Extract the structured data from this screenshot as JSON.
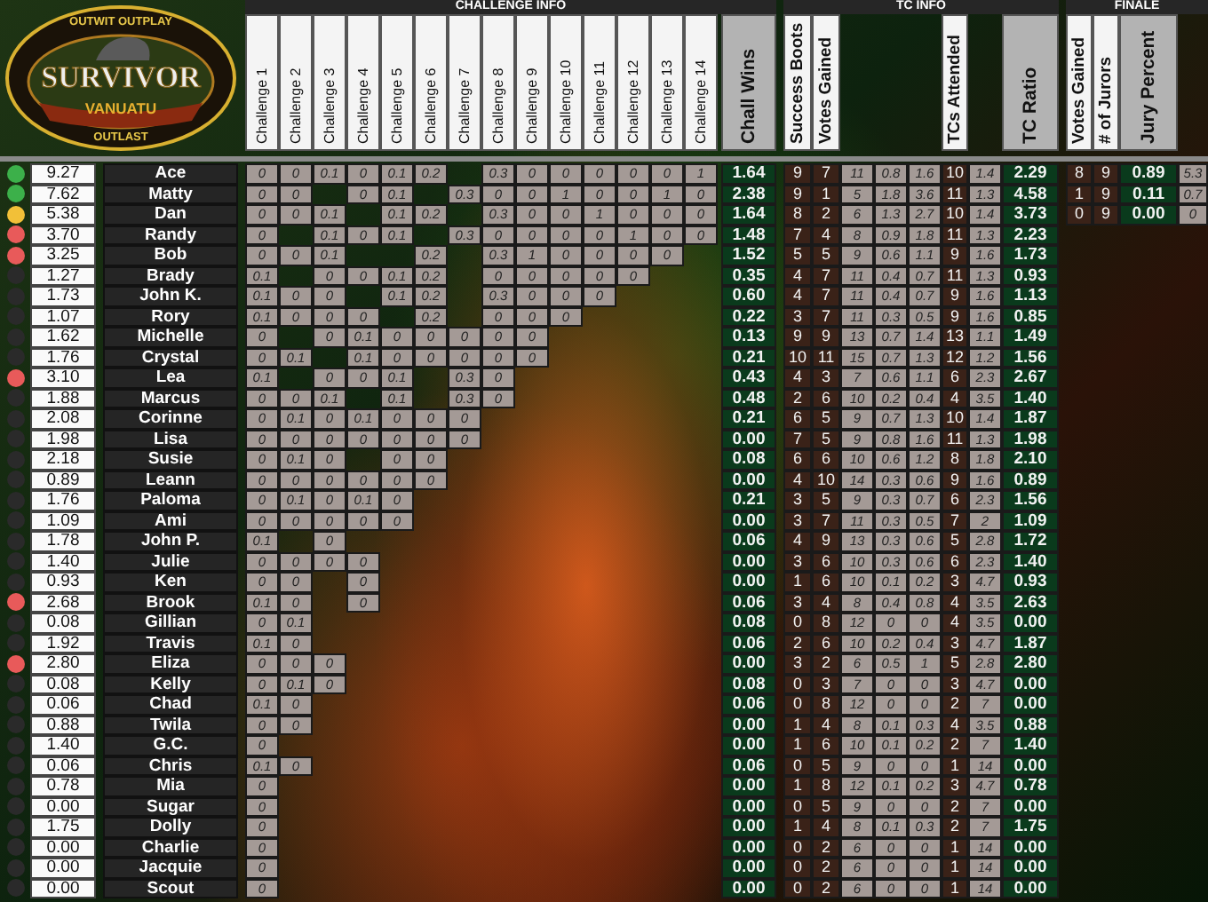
{
  "logo": {
    "top": "OUTWIT OUTPLAY",
    "title": "SURVIVOR",
    "subtitle": "VANUATU",
    "bottom": "OUTLAST"
  },
  "challenge_info": {
    "title": "CHALLENGE INFO",
    "columns": [
      "Challenge 1",
      "Challenge 2",
      "Challenge 3",
      "Challenge 4",
      "Challenge 5",
      "Challenge 6",
      "Challenge 7",
      "Challenge 8",
      "Challenge 9",
      "Challenge 10",
      "Challenge 11",
      "Challenge 12",
      "Challenge 13",
      "Challenge 14"
    ],
    "total": "Chall Wins"
  },
  "tc_info": {
    "title": "TC INFO",
    "columns": [
      {
        "label": "Success Boots",
        "kind": "dark"
      },
      {
        "label": "Votes Gained",
        "kind": "dark"
      },
      {
        "kind": "light"
      },
      {
        "kind": "light"
      },
      {
        "kind": "light"
      },
      {
        "label": "TCs Attended",
        "kind": "dark"
      },
      {
        "kind": "light"
      },
      {
        "label": "TC Ratio",
        "kind": "total"
      }
    ]
  },
  "finale": {
    "title": "FINALE",
    "columns": [
      {
        "label": "Votes Gained",
        "kind": "dark"
      },
      {
        "label": "# of Jurors",
        "kind": "dark"
      },
      {
        "label": "Jury Percent",
        "kind": "total"
      },
      {
        "kind": "light"
      }
    ]
  },
  "rows": [
    {
      "color": "#3cb04a",
      "score": "9.27",
      "name": "Ace",
      "challenges": [
        {
          "value": "0"
        },
        {
          "value": "0"
        },
        {
          "value": "0.1"
        },
        {
          "value": "0"
        },
        {
          "value": "0.1"
        },
        {
          "value": "0.2"
        },
        {
          "blank": true
        },
        {
          "value": "0.3"
        },
        {
          "value": "0"
        },
        {
          "value": "0"
        },
        {
          "value": "0"
        },
        {
          "value": "0"
        },
        {
          "value": "0"
        },
        {
          "value": "1"
        }
      ],
      "chall_wins": "1.64",
      "tc": [
        "9",
        "7",
        "11",
        "0.8",
        "1.6",
        "10",
        "1.4",
        "2.29"
      ],
      "finale": [
        "8",
        "9",
        "0.89",
        "5.3"
      ]
    },
    {
      "color": "#3cb04a",
      "score": "7.62",
      "name": "Matty",
      "challenges": [
        {
          "value": "0"
        },
        {
          "value": "0"
        },
        {
          "blank": true
        },
        {
          "value": "0"
        },
        {
          "value": "0.1"
        },
        {
          "blank": true
        },
        {
          "value": "0.3"
        },
        {
          "value": "0"
        },
        {
          "value": "0"
        },
        {
          "value": "1"
        },
        {
          "value": "0"
        },
        {
          "value": "0"
        },
        {
          "value": "1"
        },
        {
          "value": "0"
        }
      ],
      "chall_wins": "2.38",
      "tc": [
        "9",
        "1",
        "5",
        "1.8",
        "3.6",
        "11",
        "1.3",
        "4.58"
      ],
      "finale": [
        "1",
        "9",
        "0.11",
        "0.7"
      ]
    },
    {
      "color": "#f2c038",
      "score": "5.38",
      "name": "Dan",
      "challenges": [
        {
          "value": "0"
        },
        {
          "value": "0"
        },
        {
          "value": "0.1"
        },
        {
          "blank": true
        },
        {
          "value": "0.1"
        },
        {
          "value": "0.2"
        },
        {
          "blank": true
        },
        {
          "value": "0.3"
        },
        {
          "value": "0"
        },
        {
          "value": "0"
        },
        {
          "value": "1"
        },
        {
          "value": "0"
        },
        {
          "value": "0"
        },
        {
          "value": "0"
        }
      ],
      "chall_wins": "1.64",
      "tc": [
        "8",
        "2",
        "6",
        "1.3",
        "2.7",
        "10",
        "1.4",
        "3.73"
      ],
      "finale": [
        "0",
        "9",
        "0.00",
        "0"
      ]
    },
    {
      "color": "#e85a5a",
      "score": "3.70",
      "name": "Randy",
      "challenges": [
        {
          "value": "0"
        },
        {
          "blank": true
        },
        {
          "value": "0.1"
        },
        {
          "value": "0"
        },
        {
          "value": "0.1"
        },
        {
          "blank": true
        },
        {
          "value": "0.3"
        },
        {
          "value": "0"
        },
        {
          "value": "0"
        },
        {
          "value": "0"
        },
        {
          "value": "0"
        },
        {
          "value": "1"
        },
        {
          "value": "0"
        },
        {
          "value": "0"
        }
      ],
      "chall_wins": "1.48",
      "tc": [
        "7",
        "4",
        "8",
        "0.9",
        "1.8",
        "11",
        "1.3",
        "2.23"
      ]
    },
    {
      "color": "#e85a5a",
      "score": "3.25",
      "name": "Bob",
      "challenges": [
        {
          "value": "0"
        },
        {
          "value": "0"
        },
        {
          "value": "0.1"
        },
        {
          "blank": true
        },
        {
          "blank": true
        },
        {
          "value": "0.2"
        },
        {
          "blank": true
        },
        {
          "value": "0.3"
        },
        {
          "value": "1"
        },
        {
          "value": "0"
        },
        {
          "value": "0"
        },
        {
          "value": "0"
        },
        {
          "value": "0"
        }
      ],
      "chall_wins": "1.52",
      "tc": [
        "5",
        "5",
        "9",
        "0.6",
        "1.1",
        "9",
        "1.6",
        "1.73"
      ]
    },
    {
      "color": "#2a2a2a",
      "score": "1.27",
      "name": "Brady",
      "challenges": [
        {
          "value": "0.1"
        },
        {
          "blank": true
        },
        {
          "value": "0"
        },
        {
          "value": "0"
        },
        {
          "value": "0.1"
        },
        {
          "value": "0.2"
        },
        {
          "blank": true
        },
        {
          "value": "0"
        },
        {
          "value": "0"
        },
        {
          "value": "0"
        },
        {
          "value": "0"
        },
        {
          "value": "0"
        }
      ],
      "chall_wins": "0.35",
      "tc": [
        "4",
        "7",
        "11",
        "0.4",
        "0.7",
        "11",
        "1.3",
        "0.93"
      ]
    },
    {
      "color": "#2a2a2a",
      "score": "1.73",
      "name": "John K.",
      "challenges": [
        {
          "value": "0.1"
        },
        {
          "value": "0"
        },
        {
          "value": "0"
        },
        {
          "blank": true
        },
        {
          "value": "0.1"
        },
        {
          "value": "0.2"
        },
        {
          "blank": true
        },
        {
          "value": "0.3"
        },
        {
          "value": "0"
        },
        {
          "value": "0"
        },
        {
          "value": "0"
        }
      ],
      "chall_wins": "0.60",
      "tc": [
        "4",
        "7",
        "11",
        "0.4",
        "0.7",
        "9",
        "1.6",
        "1.13"
      ]
    },
    {
      "color": "#2a2a2a",
      "score": "1.07",
      "name": "Rory",
      "challenges": [
        {
          "value": "0.1"
        },
        {
          "value": "0"
        },
        {
          "value": "0"
        },
        {
          "value": "0"
        },
        {
          "blank": true
        },
        {
          "value": "0.2"
        },
        {
          "blank": true
        },
        {
          "value": "0"
        },
        {
          "value": "0"
        },
        {
          "value": "0"
        }
      ],
      "chall_wins": "0.22",
      "tc": [
        "3",
        "7",
        "11",
        "0.3",
        "0.5",
        "9",
        "1.6",
        "0.85"
      ]
    },
    {
      "color": "#2a2a2a",
      "score": "1.62",
      "name": "Michelle",
      "challenges": [
        {
          "value": "0"
        },
        {
          "blank": true
        },
        {
          "value": "0"
        },
        {
          "value": "0.1"
        },
        {
          "value": "0"
        },
        {
          "value": "0"
        },
        {
          "value": "0"
        },
        {
          "value": "0"
        },
        {
          "value": "0"
        }
      ],
      "chall_wins": "0.13",
      "tc": [
        "9",
        "9",
        "13",
        "0.7",
        "1.4",
        "13",
        "1.1",
        "1.49"
      ]
    },
    {
      "color": "#2a2a2a",
      "score": "1.76",
      "name": "Crystal",
      "challenges": [
        {
          "value": "0"
        },
        {
          "value": "0.1"
        },
        {
          "blank": true
        },
        {
          "value": "0.1"
        },
        {
          "value": "0"
        },
        {
          "value": "0"
        },
        {
          "value": "0"
        },
        {
          "value": "0"
        },
        {
          "value": "0"
        }
      ],
      "chall_wins": "0.21",
      "tc": [
        "10",
        "11",
        "15",
        "0.7",
        "1.3",
        "12",
        "1.2",
        "1.56"
      ]
    },
    {
      "color": "#e85a5a",
      "score": "3.10",
      "name": "Lea",
      "challenges": [
        {
          "value": "0.1"
        },
        {
          "blank": true
        },
        {
          "value": "0"
        },
        {
          "value": "0"
        },
        {
          "value": "0.1"
        },
        {
          "blank": true
        },
        {
          "value": "0.3"
        },
        {
          "value": "0"
        }
      ],
      "chall_wins": "0.43",
      "tc": [
        "4",
        "3",
        "7",
        "0.6",
        "1.1",
        "6",
        "2.3",
        "2.67"
      ]
    },
    {
      "color": "#2a2a2a",
      "score": "1.88",
      "name": "Marcus",
      "challenges": [
        {
          "value": "0"
        },
        {
          "value": "0"
        },
        {
          "value": "0.1"
        },
        {
          "blank": true
        },
        {
          "value": "0.1"
        },
        {
          "blank": true
        },
        {
          "value": "0.3"
        },
        {
          "value": "0"
        }
      ],
      "chall_wins": "0.48",
      "tc": [
        "2",
        "6",
        "10",
        "0.2",
        "0.4",
        "4",
        "3.5",
        "1.40"
      ]
    },
    {
      "color": "#2a2a2a",
      "score": "2.08",
      "name": "Corinne",
      "challenges": [
        {
          "value": "0"
        },
        {
          "value": "0.1"
        },
        {
          "value": "0"
        },
        {
          "value": "0.1"
        },
        {
          "value": "0"
        },
        {
          "value": "0"
        },
        {
          "value": "0"
        }
      ],
      "chall_wins": "0.21",
      "tc": [
        "6",
        "5",
        "9",
        "0.7",
        "1.3",
        "10",
        "1.4",
        "1.87"
      ]
    },
    {
      "color": "#2a2a2a",
      "score": "1.98",
      "name": "Lisa",
      "challenges": [
        {
          "value": "0"
        },
        {
          "value": "0"
        },
        {
          "value": "0"
        },
        {
          "value": "0"
        },
        {
          "value": "0"
        },
        {
          "value": "0"
        },
        {
          "value": "0"
        }
      ],
      "chall_wins": "0.00",
      "tc": [
        "7",
        "5",
        "9",
        "0.8",
        "1.6",
        "11",
        "1.3",
        "1.98"
      ]
    },
    {
      "color": "#2a2a2a",
      "score": "2.18",
      "name": "Susie",
      "challenges": [
        {
          "value": "0"
        },
        {
          "value": "0.1"
        },
        {
          "value": "0"
        },
        {
          "blank": true
        },
        {
          "value": "0"
        },
        {
          "value": "0"
        }
      ],
      "chall_wins": "0.08",
      "tc": [
        "6",
        "6",
        "10",
        "0.6",
        "1.2",
        "8",
        "1.8",
        "2.10"
      ]
    },
    {
      "color": "#2a2a2a",
      "score": "0.89",
      "name": "Leann",
      "challenges": [
        {
          "value": "0"
        },
        {
          "value": "0"
        },
        {
          "value": "0"
        },
        {
          "value": "0"
        },
        {
          "value": "0"
        },
        {
          "value": "0"
        }
      ],
      "chall_wins": "0.00",
      "tc": [
        "4",
        "10",
        "14",
        "0.3",
        "0.6",
        "9",
        "1.6",
        "0.89"
      ]
    },
    {
      "color": "#2a2a2a",
      "score": "1.76",
      "name": "Paloma",
      "challenges": [
        {
          "value": "0"
        },
        {
          "value": "0.1"
        },
        {
          "value": "0"
        },
        {
          "value": "0.1"
        },
        {
          "value": "0"
        }
      ],
      "chall_wins": "0.21",
      "tc": [
        "3",
        "5",
        "9",
        "0.3",
        "0.7",
        "6",
        "2.3",
        "1.56"
      ]
    },
    {
      "color": "#2a2a2a",
      "score": "1.09",
      "name": "Ami",
      "challenges": [
        {
          "value": "0"
        },
        {
          "value": "0"
        },
        {
          "value": "0"
        },
        {
          "value": "0"
        },
        {
          "value": "0"
        }
      ],
      "chall_wins": "0.00",
      "tc": [
        "3",
        "7",
        "11",
        "0.3",
        "0.5",
        "7",
        "2",
        "1.09"
      ]
    },
    {
      "color": "#2a2a2a",
      "score": "1.78",
      "name": "John P.",
      "challenges": [
        {
          "value": "0.1"
        },
        {
          "blank": true
        },
        {
          "value": "0"
        }
      ],
      "chall_wins": "0.06",
      "tc": [
        "4",
        "9",
        "13",
        "0.3",
        "0.6",
        "5",
        "2.8",
        "1.72"
      ]
    },
    {
      "color": "#2a2a2a",
      "score": "1.40",
      "name": "Julie",
      "challenges": [
        {
          "value": "0"
        },
        {
          "value": "0"
        },
        {
          "value": "0"
        },
        {
          "value": "0"
        }
      ],
      "chall_wins": "0.00",
      "tc": [
        "3",
        "6",
        "10",
        "0.3",
        "0.6",
        "6",
        "2.3",
        "1.40"
      ]
    },
    {
      "color": "#2a2a2a",
      "score": "0.93",
      "name": "Ken",
      "challenges": [
        {
          "value": "0"
        },
        {
          "value": "0"
        },
        {
          "blank": true
        },
        {
          "value": "0"
        }
      ],
      "chall_wins": "0.00",
      "tc": [
        "1",
        "6",
        "10",
        "0.1",
        "0.2",
        "3",
        "4.7",
        "0.93"
      ]
    },
    {
      "color": "#e85a5a",
      "score": "2.68",
      "name": "Brook",
      "challenges": [
        {
          "value": "0.1"
        },
        {
          "value": "0"
        },
        {
          "blank": true
        },
        {
          "value": "0"
        }
      ],
      "chall_wins": "0.06",
      "tc": [
        "3",
        "4",
        "8",
        "0.4",
        "0.8",
        "4",
        "3.5",
        "2.63"
      ]
    },
    {
      "color": "#2a2a2a",
      "score": "0.08",
      "name": "Gillian",
      "challenges": [
        {
          "value": "0"
        },
        {
          "value": "0.1"
        }
      ],
      "chall_wins": "0.08",
      "tc": [
        "0",
        "8",
        "12",
        "0",
        "0",
        "4",
        "3.5",
        "0.00"
      ]
    },
    {
      "color": "#2a2a2a",
      "score": "1.92",
      "name": "Travis",
      "challenges": [
        {
          "value": "0.1"
        },
        {
          "value": "0"
        }
      ],
      "chall_wins": "0.06",
      "tc": [
        "2",
        "6",
        "10",
        "0.2",
        "0.4",
        "3",
        "4.7",
        "1.87"
      ]
    },
    {
      "color": "#e85a5a",
      "score": "2.80",
      "name": "Eliza",
      "challenges": [
        {
          "value": "0"
        },
        {
          "value": "0"
        },
        {
          "value": "0"
        }
      ],
      "chall_wins": "0.00",
      "tc": [
        "3",
        "2",
        "6",
        "0.5",
        "1",
        "5",
        "2.8",
        "2.80"
      ]
    },
    {
      "color": "#2a2a2a",
      "score": "0.08",
      "name": "Kelly",
      "challenges": [
        {
          "value": "0"
        },
        {
          "value": "0.1"
        },
        {
          "value": "0"
        }
      ],
      "chall_wins": "0.08",
      "tc": [
        "0",
        "3",
        "7",
        "0",
        "0",
        "3",
        "4.7",
        "0.00"
      ]
    },
    {
      "color": "#2a2a2a",
      "score": "0.06",
      "name": "Chad",
      "challenges": [
        {
          "value": "0.1"
        },
        {
          "value": "0"
        }
      ],
      "chall_wins": "0.06",
      "tc": [
        "0",
        "8",
        "12",
        "0",
        "0",
        "2",
        "7",
        "0.00"
      ]
    },
    {
      "color": "#2a2a2a",
      "score": "0.88",
      "name": "Twila",
      "challenges": [
        {
          "value": "0"
        },
        {
          "value": "0"
        }
      ],
      "chall_wins": "0.00",
      "tc": [
        "1",
        "4",
        "8",
        "0.1",
        "0.3",
        "4",
        "3.5",
        "0.88"
      ]
    },
    {
      "color": "#2a2a2a",
      "score": "1.40",
      "name": "G.C.",
      "challenges": [
        {
          "value": "0"
        }
      ],
      "chall_wins": "0.00",
      "tc": [
        "1",
        "6",
        "10",
        "0.1",
        "0.2",
        "2",
        "7",
        "1.40"
      ]
    },
    {
      "color": "#2a2a2a",
      "score": "0.06",
      "name": "Chris",
      "challenges": [
        {
          "value": "0.1"
        },
        {
          "value": "0"
        }
      ],
      "chall_wins": "0.06",
      "tc": [
        "0",
        "5",
        "9",
        "0",
        "0",
        "1",
        "14",
        "0.00"
      ]
    },
    {
      "color": "#2a2a2a",
      "score": "0.78",
      "name": "Mia",
      "challenges": [
        {
          "value": "0"
        }
      ],
      "chall_wins": "0.00",
      "tc": [
        "1",
        "8",
        "12",
        "0.1",
        "0.2",
        "3",
        "4.7",
        "0.78"
      ]
    },
    {
      "color": "#2a2a2a",
      "score": "0.00",
      "name": "Sugar",
      "challenges": [
        {
          "value": "0"
        }
      ],
      "chall_wins": "0.00",
      "tc": [
        "0",
        "5",
        "9",
        "0",
        "0",
        "2",
        "7",
        "0.00"
      ]
    },
    {
      "color": "#2a2a2a",
      "score": "1.75",
      "name": "Dolly",
      "challenges": [
        {
          "value": "0"
        }
      ],
      "chall_wins": "0.00",
      "tc": [
        "1",
        "4",
        "8",
        "0.1",
        "0.3",
        "2",
        "7",
        "1.75"
      ]
    },
    {
      "color": "#2a2a2a",
      "score": "0.00",
      "name": "Charlie",
      "challenges": [
        {
          "value": "0"
        }
      ],
      "chall_wins": "0.00",
      "tc": [
        "0",
        "2",
        "6",
        "0",
        "0",
        "1",
        "14",
        "0.00"
      ]
    },
    {
      "color": "#2a2a2a",
      "score": "0.00",
      "name": "Jacquie",
      "challenges": [
        {
          "value": "0"
        }
      ],
      "chall_wins": "0.00",
      "tc": [
        "0",
        "2",
        "6",
        "0",
        "0",
        "1",
        "14",
        "0.00"
      ]
    },
    {
      "color": "#2a2a2a",
      "score": "0.00",
      "name": "Scout",
      "challenges": [
        {
          "value": "0"
        }
      ],
      "chall_wins": "0.00",
      "tc": [
        "0",
        "2",
        "6",
        "0",
        "0",
        "1",
        "14",
        "0.00"
      ]
    }
  ]
}
